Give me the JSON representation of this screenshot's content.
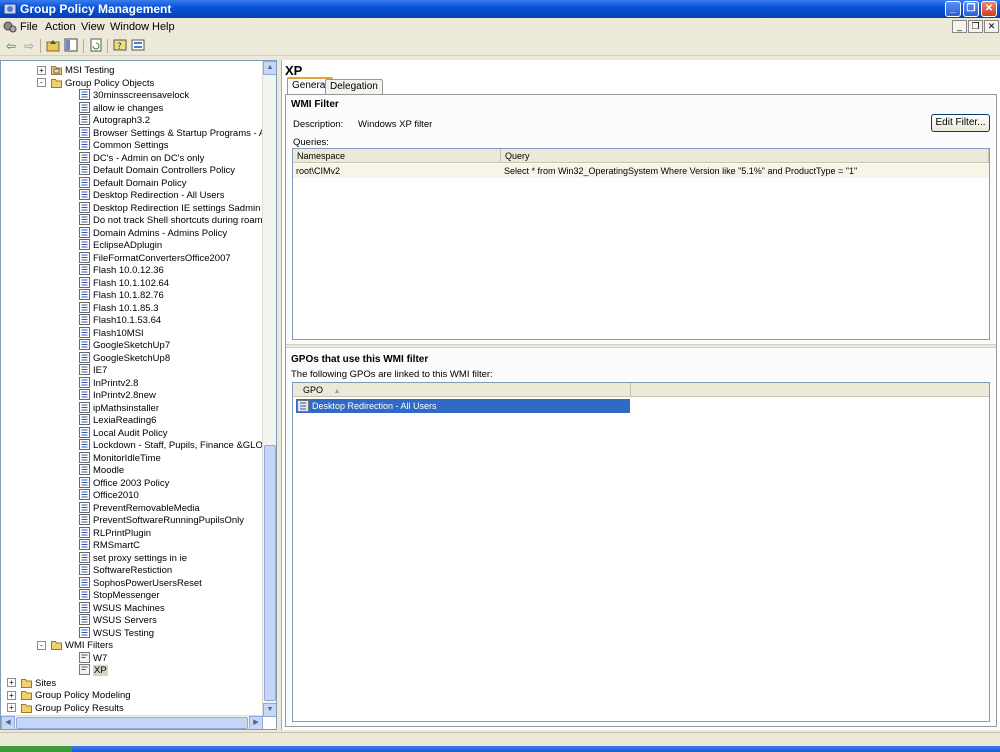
{
  "window": {
    "title": "Group Policy Management",
    "minimize": "_",
    "maximize": "❐",
    "close": "✕"
  },
  "menu": {
    "items": [
      "File",
      "Action",
      "View",
      "Window",
      "Help"
    ]
  },
  "tree": {
    "items": [
      {
        "label": "MSI Testing",
        "level": 3,
        "type": "ou",
        "expander": "+"
      },
      {
        "label": "Group Policy Objects",
        "level": 3,
        "type": "folder",
        "expander": "-"
      },
      {
        "label": "30minsscreensavelock",
        "level": 4,
        "type": "gpo"
      },
      {
        "label": "allow ie changes",
        "level": 4,
        "type": "gpo"
      },
      {
        "label": "Autograph3.2",
        "level": 4,
        "type": "gpo"
      },
      {
        "label": "Browser Settings & Startup Programs - All Us",
        "level": 4,
        "type": "gpo"
      },
      {
        "label": "Common Settings",
        "level": 4,
        "type": "gpo"
      },
      {
        "label": "DC's - Admin on DC's only",
        "level": 4,
        "type": "gpo"
      },
      {
        "label": "Default Domain Controllers Policy",
        "level": 4,
        "type": "gpo"
      },
      {
        "label": "Default Domain Policy",
        "level": 4,
        "type": "gpo"
      },
      {
        "label": "Desktop Redirection - All Users",
        "level": 4,
        "type": "gpo"
      },
      {
        "label": "Desktop Redirection IE settings Sadmin",
        "level": 4,
        "type": "gpo"
      },
      {
        "label": "Do not track Shell shortcuts during roaming",
        "level": 4,
        "type": "gpo"
      },
      {
        "label": "Domain Admins - Admins Policy",
        "level": 4,
        "type": "gpo"
      },
      {
        "label": "EclipseADplugin",
        "level": 4,
        "type": "gpo"
      },
      {
        "label": "FileFormatConvertersOffice2007",
        "level": 4,
        "type": "gpo"
      },
      {
        "label": "Flash 10.0.12.36",
        "level": 4,
        "type": "gpo"
      },
      {
        "label": "Flash 10.1.102.64",
        "level": 4,
        "type": "gpo"
      },
      {
        "label": "Flash 10.1.82.76",
        "level": 4,
        "type": "gpo"
      },
      {
        "label": "Flash 10.1.85.3",
        "level": 4,
        "type": "gpo"
      },
      {
        "label": "Flash10.1.53.64",
        "level": 4,
        "type": "gpo"
      },
      {
        "label": "Flash10MSI",
        "level": 4,
        "type": "gpo"
      },
      {
        "label": "GoogleSketchUp7",
        "level": 4,
        "type": "gpo"
      },
      {
        "label": "GoogleSketchUp8",
        "level": 4,
        "type": "gpo"
      },
      {
        "label": "IE7",
        "level": 4,
        "type": "gpo"
      },
      {
        "label": "InPrintv2.8",
        "level": 4,
        "type": "gpo"
      },
      {
        "label": "InPrintv2.8new",
        "level": 4,
        "type": "gpo"
      },
      {
        "label": "ipMathsinstaller",
        "level": 4,
        "type": "gpo"
      },
      {
        "label": "LexiaReading6",
        "level": 4,
        "type": "gpo"
      },
      {
        "label": "Local Audit Policy",
        "level": 4,
        "type": "gpo"
      },
      {
        "label": "Lockdown - Staff, Pupils, Finance &GLOSCAT",
        "level": 4,
        "type": "gpo"
      },
      {
        "label": "MonitorIdleTime",
        "level": 4,
        "type": "gpo"
      },
      {
        "label": "Moodle",
        "level": 4,
        "type": "gpo"
      },
      {
        "label": "Office 2003 Policy",
        "level": 4,
        "type": "gpo"
      },
      {
        "label": "Office2010",
        "level": 4,
        "type": "gpo"
      },
      {
        "label": "PreventRemovableMedia",
        "level": 4,
        "type": "gpo"
      },
      {
        "label": "PreventSoftwareRunningPupilsOnly",
        "level": 4,
        "type": "gpo"
      },
      {
        "label": "RLPrintPlugin",
        "level": 4,
        "type": "gpo"
      },
      {
        "label": "RMSmartC",
        "level": 4,
        "type": "gpo"
      },
      {
        "label": "set proxy settings in ie",
        "level": 4,
        "type": "gpo"
      },
      {
        "label": "SoftwareRestiction",
        "level": 4,
        "type": "gpo"
      },
      {
        "label": "SophosPowerUsersReset",
        "level": 4,
        "type": "gpo"
      },
      {
        "label": "StopMessenger",
        "level": 4,
        "type": "gpo"
      },
      {
        "label": "WSUS Machines",
        "level": 4,
        "type": "gpo"
      },
      {
        "label": "WSUS Servers",
        "level": 4,
        "type": "gpo"
      },
      {
        "label": "WSUS Testing",
        "level": 4,
        "type": "gpo"
      },
      {
        "label": "WMI Filters",
        "level": 3,
        "type": "folder",
        "expander": "-"
      },
      {
        "label": "W7",
        "level": 4,
        "type": "wmi"
      },
      {
        "label": "XP",
        "level": 4,
        "type": "wmi",
        "selected": true
      },
      {
        "label": "Sites",
        "level": 1,
        "type": "folder",
        "expander": "+"
      },
      {
        "label": "Group Policy Modeling",
        "level": 1,
        "type": "folder",
        "expander": "+"
      },
      {
        "label": "Group Policy Results",
        "level": 1,
        "type": "folder",
        "expander": "+"
      }
    ]
  },
  "details": {
    "title": "XP",
    "tabs": [
      "General",
      "Delegation"
    ],
    "active_tab": "General",
    "wmi_section_title": "WMI Filter",
    "description_label": "Description:",
    "description_value": "Windows XP filter",
    "edit_button": "Edit Filter...",
    "queries_label": "Queries:",
    "queries_columns": [
      "Namespace",
      "Query"
    ],
    "queries_rows": [
      {
        "namespace": "root\\CIMv2",
        "query": "Select * from Win32_OperatingSystem Where Version like \"5.1%\" and ProductType = \"1\""
      }
    ],
    "gpos_section_title": "GPOs that use this WMI filter",
    "gpos_info": "The following GPOs are linked to this WMI filter:",
    "gpos_column": "GPO",
    "gpos_sort_indicator": "▲",
    "gpos_rows": [
      "Desktop Redirection - All Users"
    ]
  }
}
